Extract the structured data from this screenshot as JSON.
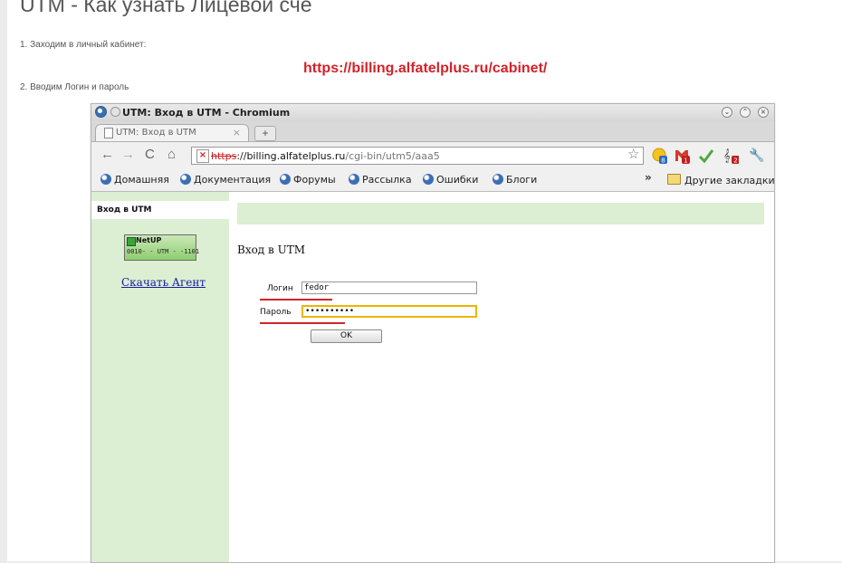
{
  "article": {
    "title": "UTM - Как узнать Лицевой сче",
    "step1": "1. Заходим в личный кабинет:",
    "billing_url": "https://billing.alfatelplus.ru/cabinet/",
    "step2": "2. Вводим Логин и пароль"
  },
  "browser": {
    "window_title": "UTM: Вход в UTM - Chromium",
    "tab_title": "UTM: Вход в UTM",
    "tab_close": "×",
    "new_tab": "+",
    "url_scheme": "https",
    "url_sep": "://",
    "url_host": "billing.alfatelplus.ru",
    "url_path": "/cgi-bin/utm5/aaa5",
    "extension_badges": {
      "ext1": "8",
      "gmail": "1",
      "ext3": "2"
    },
    "bookmarks": [
      "Домашняя",
      "Документация",
      "Форумы",
      "Рассылка",
      "Ошибки",
      "Блоги"
    ],
    "bookmarks_overflow": "»",
    "other_bookmarks": "Другие закладки"
  },
  "utm": {
    "sidebar_tab": "Вход в UTM",
    "logo": {
      "brand": "NetUP",
      "row": "0010- - UTM - -1101"
    },
    "download_link": "Скачать Агент",
    "heading": "Вход в UTM",
    "login_label": "Логин",
    "login_value": "fedor",
    "password_label": "Пароль",
    "password_value": "••••••••••",
    "ok_button": "OK"
  },
  "colors": {
    "accent_red": "#d2232a",
    "sidebar_green": "#dcefd2",
    "focus_orange": "#f0b400"
  }
}
